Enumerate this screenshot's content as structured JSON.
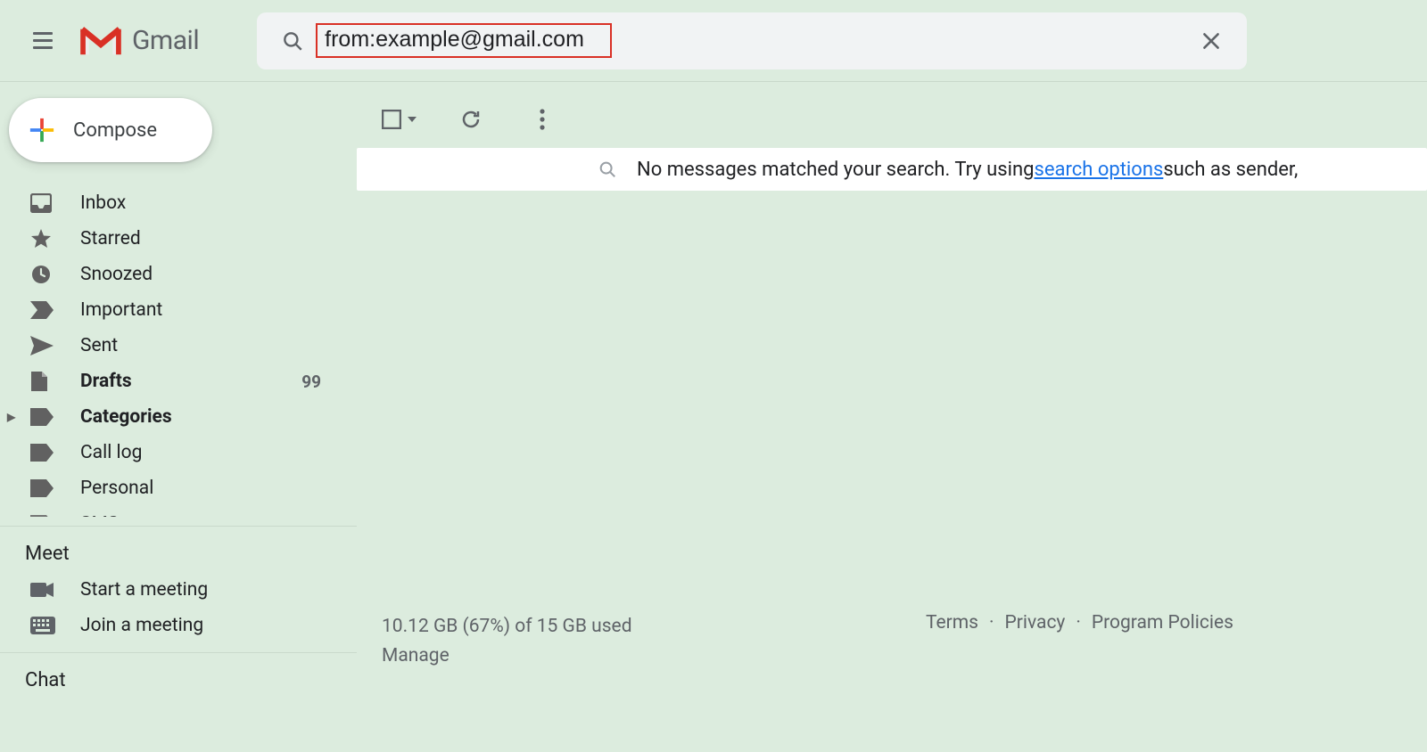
{
  "header": {
    "app_name": "Gmail",
    "search_value": "from:example@gmail.com"
  },
  "compose": {
    "label": "Compose"
  },
  "nav": {
    "items": [
      {
        "label": "Inbox",
        "icon": "inbox",
        "bold": false,
        "count": ""
      },
      {
        "label": "Starred",
        "icon": "star",
        "bold": false,
        "count": ""
      },
      {
        "label": "Snoozed",
        "icon": "clock",
        "bold": false,
        "count": ""
      },
      {
        "label": "Important",
        "icon": "important",
        "bold": false,
        "count": ""
      },
      {
        "label": "Sent",
        "icon": "sent",
        "bold": false,
        "count": ""
      },
      {
        "label": "Drafts",
        "icon": "file",
        "bold": true,
        "count": "99"
      },
      {
        "label": "Categories",
        "icon": "label",
        "bold": true,
        "count": "",
        "expandable": true
      },
      {
        "label": "Call log",
        "icon": "label",
        "bold": false,
        "count": ""
      },
      {
        "label": "Personal",
        "icon": "label",
        "bold": false,
        "count": ""
      },
      {
        "label": "SMS",
        "icon": "label",
        "bold": false,
        "count": ""
      }
    ]
  },
  "meet": {
    "title": "Meet",
    "start": "Start a meeting",
    "join": "Join a meeting"
  },
  "chat": {
    "title": "Chat"
  },
  "results": {
    "empty_prefix": "No messages matched your search. Try using ",
    "link_text": "search options",
    "empty_suffix": " such as sender,"
  },
  "footer": {
    "storage_line": "10.12 GB (67%) of 15 GB used",
    "manage": "Manage",
    "terms": "Terms",
    "privacy": "Privacy",
    "policies": "Program Policies"
  }
}
